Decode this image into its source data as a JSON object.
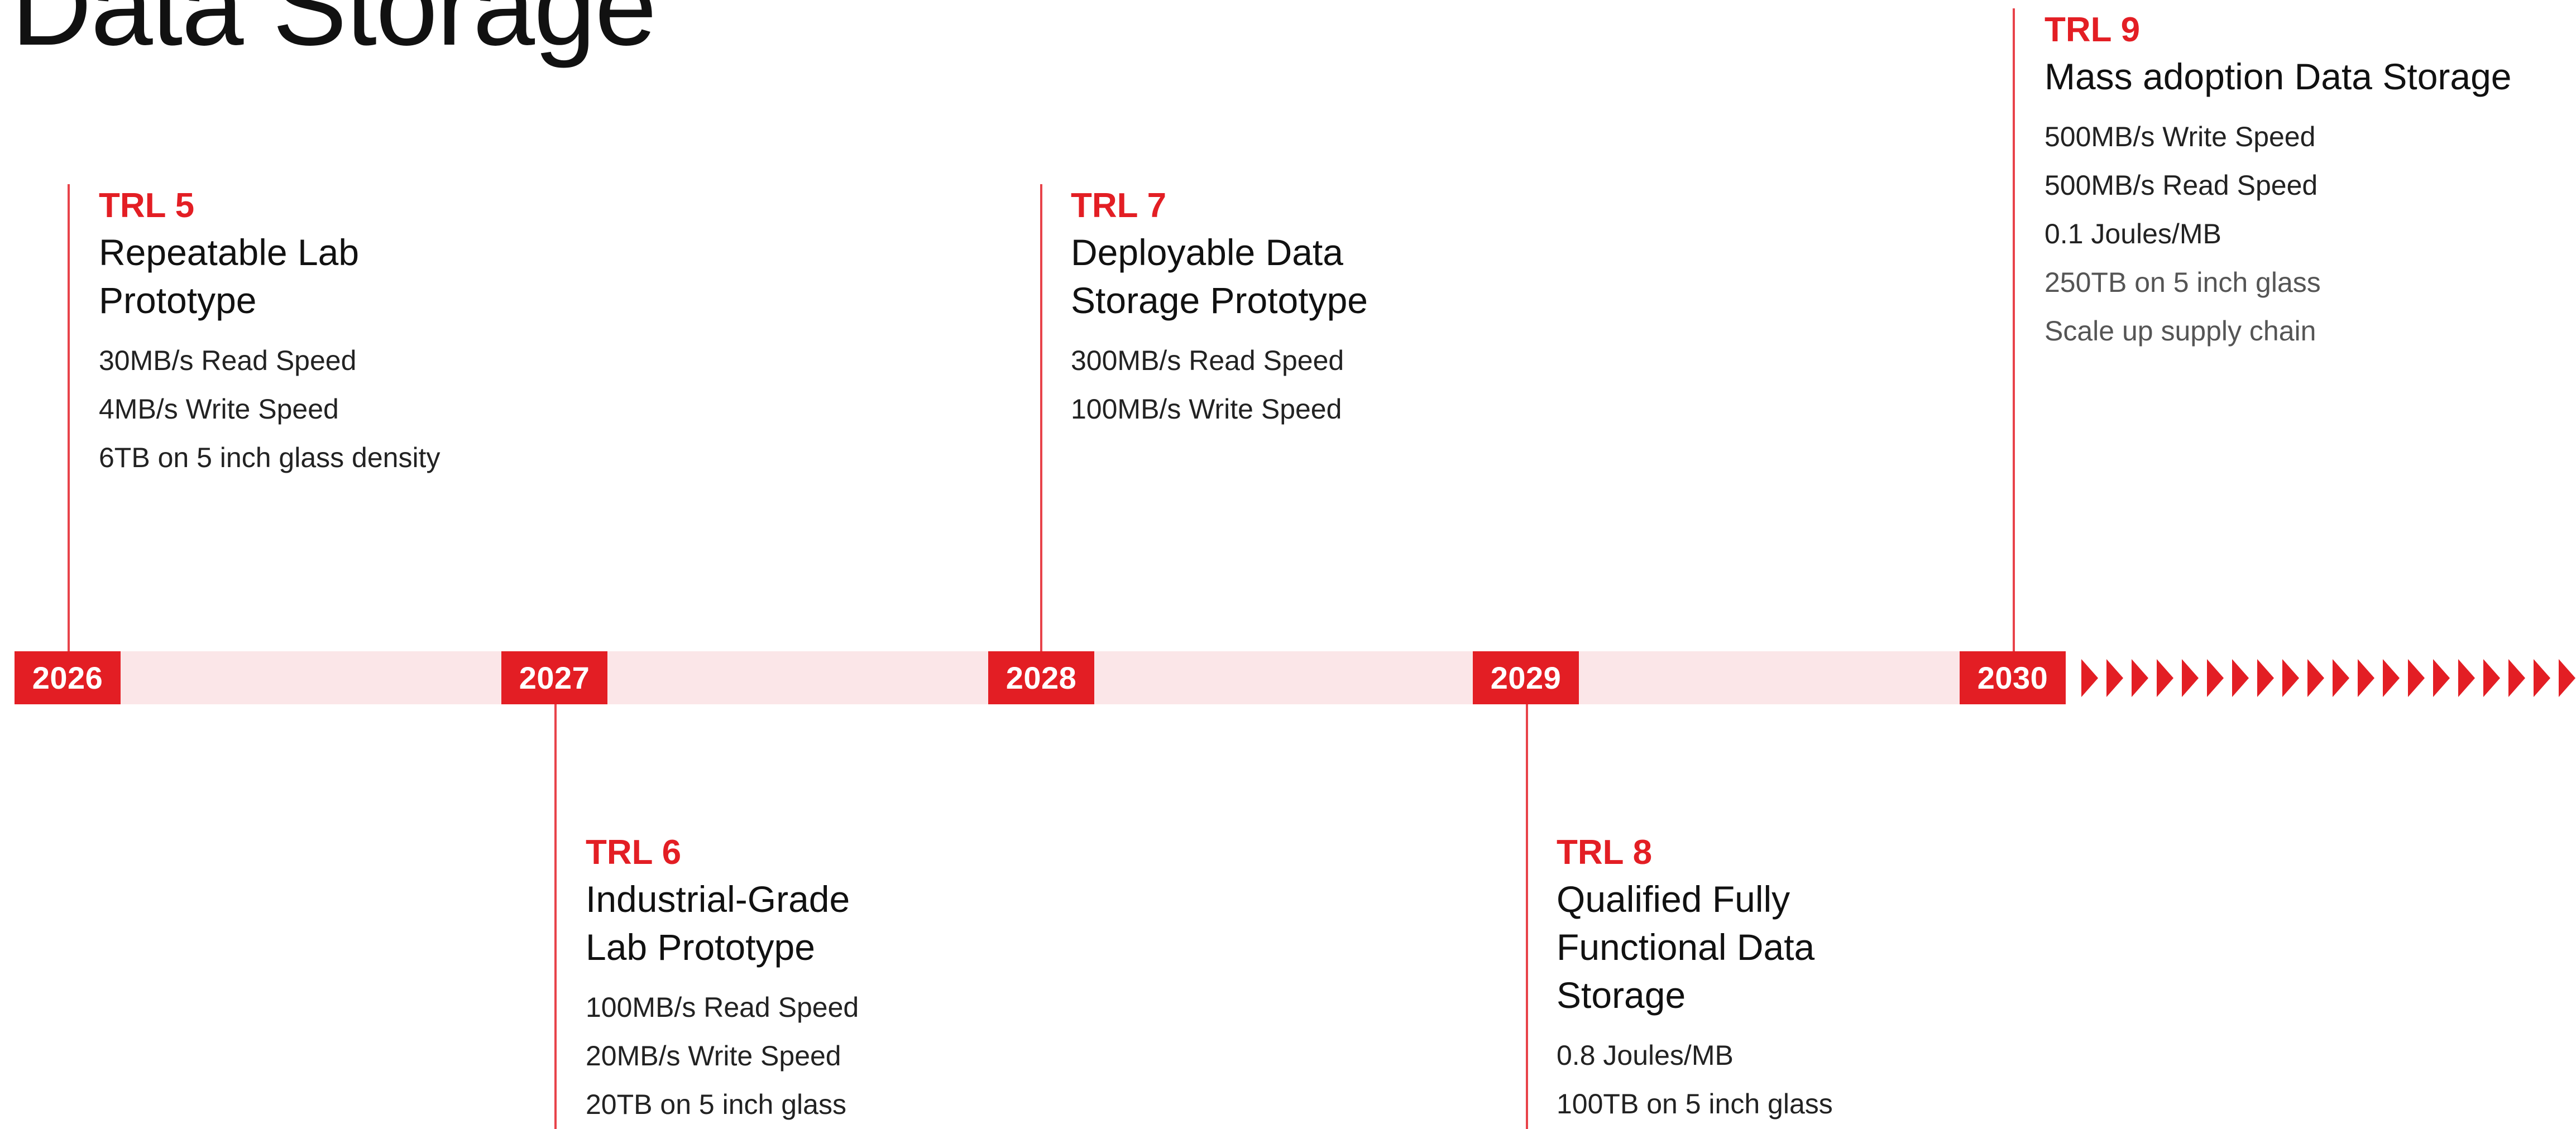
{
  "page_title": "Data Storage",
  "colors": {
    "accent": "#e31e24",
    "band": "#fbe6e8",
    "text": "#111111"
  },
  "years": [
    "2026",
    "2027",
    "2028",
    "2029",
    "2030"
  ],
  "milestones": [
    {
      "trl": "TRL 5",
      "title_lines": [
        "Repeatable Lab",
        "Prototype"
      ],
      "specs": [
        "30MB/s Read Speed",
        "4MB/s Write Speed",
        "6TB on 5 inch glass density"
      ]
    },
    {
      "trl": "TRL 6",
      "title_lines": [
        "Industrial-Grade",
        "Lab Prototype"
      ],
      "specs": [
        "100MB/s Read Speed",
        "20MB/s Write Speed",
        "20TB on 5 inch glass"
      ]
    },
    {
      "trl": "TRL 7",
      "title_lines": [
        "Deployable Data",
        "Storage Prototype"
      ],
      "specs": [
        "300MB/s Read Speed",
        "100MB/s Write Speed"
      ]
    },
    {
      "trl": "TRL 8",
      "title_lines": [
        "Qualified Fully",
        "Functional Data",
        "Storage"
      ],
      "specs": [
        "0.8 Joules/MB",
        "100TB on 5 inch glass"
      ]
    },
    {
      "trl": "TRL 9",
      "title_lines": [
        "Mass adoption Data Storage"
      ],
      "specs": [
        "500MB/s Write Speed",
        "500MB/s Read Speed",
        "0.1 Joules/MB",
        "250TB on 5 inch glass",
        "Scale up supply chain"
      ]
    }
  ]
}
